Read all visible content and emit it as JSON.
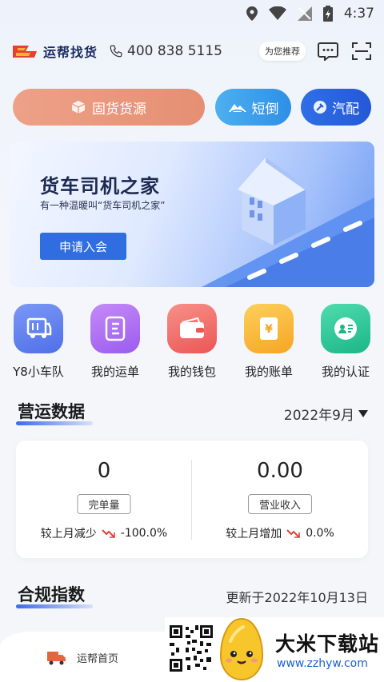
{
  "status": {
    "time": "4:37"
  },
  "header": {
    "logo_text": "运帮找货",
    "phone": "400 838 5115",
    "recommend": "为您推荐"
  },
  "top_buttons": {
    "cargo": "固货货源",
    "short": "短倒",
    "parts": "汽配"
  },
  "banner": {
    "title": "货车司机之家",
    "subtitle": "有一种温暖叫“货车司机之家”",
    "button": "申请入会"
  },
  "menu": [
    {
      "label": "Y8小车队",
      "icon": "truck-icon",
      "color": "#5b7df0"
    },
    {
      "label": "我的运单",
      "icon": "waybill-icon",
      "color": "#a868f0"
    },
    {
      "label": "我的钱包",
      "icon": "wallet-icon",
      "color": "#f06a6a"
    },
    {
      "label": "我的账单",
      "icon": "bill-icon",
      "color": "#f8b23c"
    },
    {
      "label": "我的认证",
      "icon": "id-card-icon",
      "color": "#2fcb9a"
    }
  ],
  "operations": {
    "title": "营运数据",
    "month": "2022年9月",
    "completed": {
      "value": "0",
      "tag": "完单量",
      "compare_label": "较上月减少",
      "compare_value": "-100.0%"
    },
    "income": {
      "value": "0.00",
      "tag": "营业收入",
      "compare_label": "较上月增加",
      "compare_value": "0.0%"
    }
  },
  "compliance": {
    "title": "合规指数",
    "updated": "更新于2022年10月13日"
  },
  "tabbar": {
    "home": "运帮首页"
  },
  "watermark": {
    "name": "大米下载站",
    "url": "www.zzhyw.com"
  },
  "colors": {
    "accent": "#2f6de0",
    "cargo": "#e9967a",
    "down": "#e0413c"
  }
}
